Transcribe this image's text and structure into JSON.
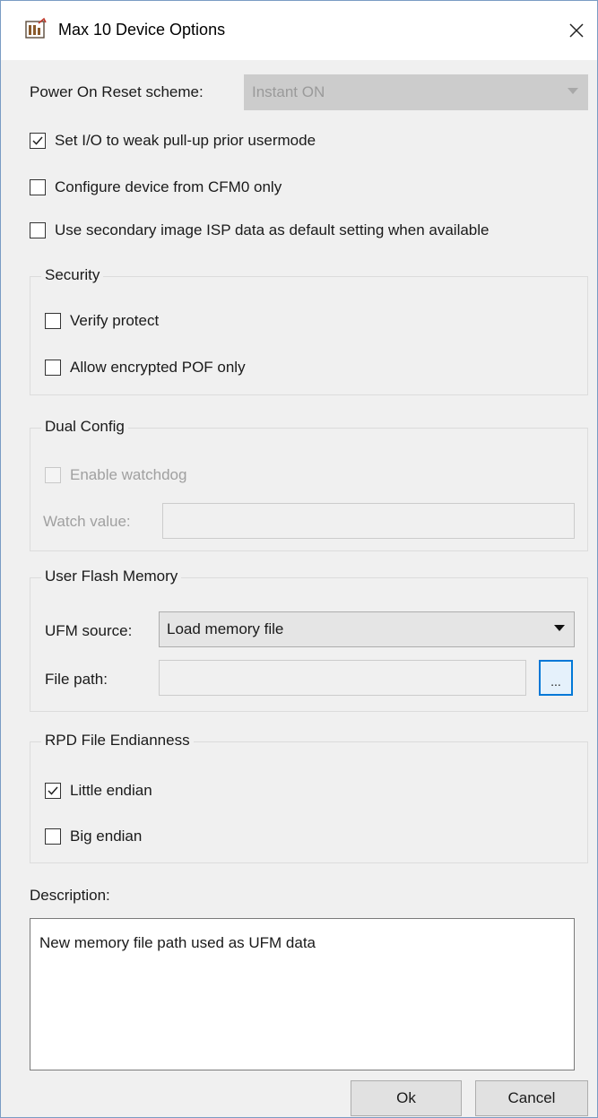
{
  "window": {
    "title": "Max 10 Device Options"
  },
  "power_on_reset": {
    "label": "Power On Reset scheme:",
    "value": "Instant ON"
  },
  "options": {
    "weak_pullup": {
      "label": "Set I/O to weak pull-up prior usermode",
      "checked": true
    },
    "cfm0_only": {
      "label": "Configure device from CFM0 only",
      "checked": false
    },
    "secondary_isp": {
      "label": "Use secondary image ISP data as default setting when available",
      "checked": false
    }
  },
  "security": {
    "title": "Security",
    "verify_protect": {
      "label": "Verify protect",
      "checked": false
    },
    "encrypted_pof": {
      "label": "Allow encrypted POF only",
      "checked": false
    }
  },
  "dual_config": {
    "title": "Dual Config",
    "enable_watchdog": {
      "label": "Enable watchdog",
      "checked": false
    },
    "watch_value": {
      "label": "Watch value:",
      "value": ""
    }
  },
  "user_flash_memory": {
    "title": "User Flash Memory",
    "ufm_source": {
      "label": "UFM source:",
      "value": "Load memory file"
    },
    "file_path": {
      "label": "File path:",
      "value": ""
    },
    "browse_label": "..."
  },
  "rpd_endianness": {
    "title": "RPD File Endianness",
    "little_endian": {
      "label": "Little endian",
      "checked": true
    },
    "big_endian": {
      "label": "Big endian",
      "checked": false
    }
  },
  "description": {
    "label": "Description:",
    "text": "New memory file path used as UFM data"
  },
  "buttons": {
    "ok": "Ok",
    "cancel": "Cancel"
  },
  "icons": {
    "app": "max10-app-icon",
    "close": "close-icon",
    "dropdown": "chevron-down-icon",
    "check": "check-icon"
  },
  "colors": {
    "accent": "#0078d7",
    "window_bg": "#f0f0f0",
    "border": "#7a9cc4"
  }
}
